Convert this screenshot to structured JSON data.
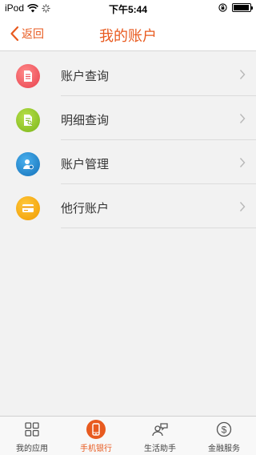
{
  "statusbar": {
    "carrier": "iPod",
    "time": "下午5:44",
    "battery_level": 0.95
  },
  "navbar": {
    "back_label": "返回",
    "title": "我的账户"
  },
  "menu": {
    "items": [
      {
        "label": "账户查询",
        "icon": "account-inquiry-icon",
        "color": "#f0505a"
      },
      {
        "label": "明细查询",
        "icon": "detail-inquiry-icon",
        "color": "#8dc21f"
      },
      {
        "label": "账户管理",
        "icon": "account-management-icon",
        "color": "#1a86d0"
      },
      {
        "label": "他行账户",
        "icon": "other-bank-account-icon",
        "color": "#f5a000"
      }
    ]
  },
  "tabbar": {
    "tabs": [
      {
        "label": "我的应用",
        "icon": "grid-apps-icon",
        "active": false
      },
      {
        "label": "手机银行",
        "icon": "mobile-phone-icon",
        "active": true
      },
      {
        "label": "生活助手",
        "icon": "life-assistant-icon",
        "active": false
      },
      {
        "label": "金融服务",
        "icon": "dollar-coin-icon",
        "active": false
      }
    ]
  },
  "colors": {
    "accent": "#e85a1f",
    "background": "#f2f2f2"
  }
}
